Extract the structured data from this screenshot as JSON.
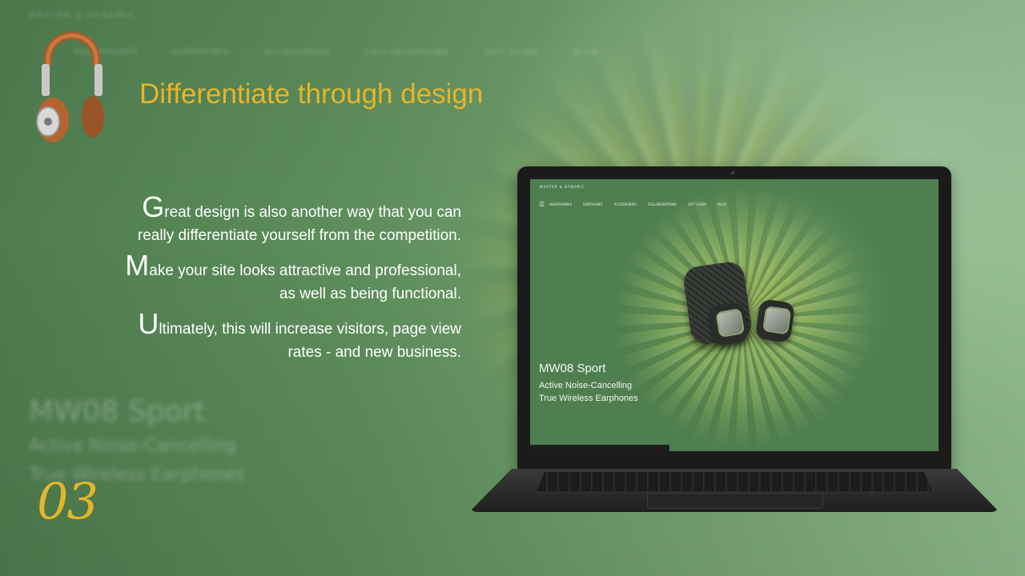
{
  "background": {
    "brand": "MASTER & DYNAMIC",
    "nav": [
      "HEADPHONES",
      "EARPHONES",
      "ACCESSORIES",
      "COLLABORATIONS",
      "GIFT GUIDE",
      "BLOG"
    ],
    "ghost_title": "MW08 Sport",
    "ghost_subtitle": [
      "Active Noise-Cancelling",
      "True Wireless Earphones"
    ]
  },
  "slide": {
    "title": "Differentiate through design",
    "paragraphs": [
      {
        "cap": "G",
        "text": "reat design is also another way that you can really differentiate yourself from the competition."
      },
      {
        "cap": "M",
        "text": "ake  your site looks attractive and professional, as well as being functional."
      },
      {
        "cap": "U",
        "text": "ltimately, this will increase visitors, page view rates - and new business."
      }
    ],
    "page_number": "03"
  },
  "screen": {
    "brand": "MASTER & DYNAMIC",
    "nav": [
      "HEADPHONES",
      "EARPHONES",
      "ACCESSORIES",
      "COLLABORATIONS",
      "GIFT GUIDE",
      "BLOG"
    ],
    "product_title": "MW08 Sport",
    "product_subtitle_1": "Active Noise-Cancelling",
    "product_subtitle_2": "True Wireless Earphones"
  },
  "colors": {
    "title": "#e5b52a",
    "page_number": "#e5b52a",
    "body_text": "#ffffff",
    "background": "#5f8d5d"
  }
}
